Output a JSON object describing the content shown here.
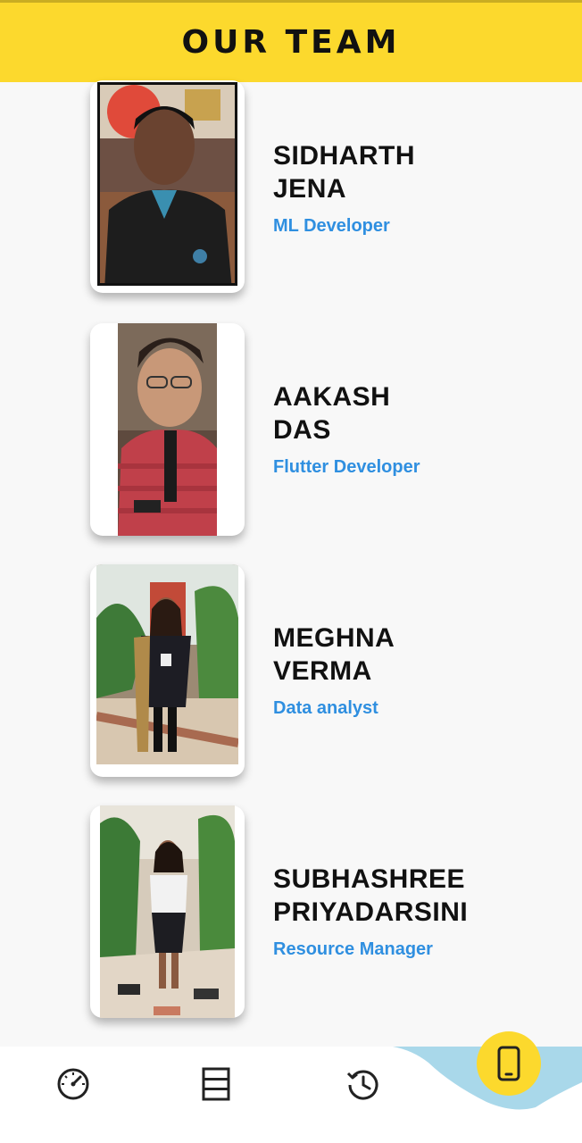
{
  "header": {
    "title": "OUR TEAM"
  },
  "members": [
    {
      "name_line1": "SIDHARTH",
      "name_line2": "JENA",
      "role": "ML Developer"
    },
    {
      "name_line1": "AAKASH",
      "name_line2": "DAS",
      "role": "Flutter Developer"
    },
    {
      "name_line1": "MEGHNA",
      "name_line2": "VERMA",
      "role": "Data analyst"
    },
    {
      "name_line1": "SUBHASHREE",
      "name_line2": "PRIYADARSINI",
      "role": "Resource Manager"
    }
  ],
  "bottom_nav": {
    "items": [
      {
        "icon": "speedometer-icon"
      },
      {
        "icon": "list-view-icon"
      },
      {
        "icon": "history-icon"
      },
      {
        "icon": "mobile-phone-icon",
        "active": true
      }
    ],
    "accent_color": "#fcd92d",
    "wave_color": "#a9d8ea"
  },
  "colors": {
    "header_bg": "#fcd92d",
    "role_text": "#2f8fe0",
    "name_text": "#111111"
  }
}
